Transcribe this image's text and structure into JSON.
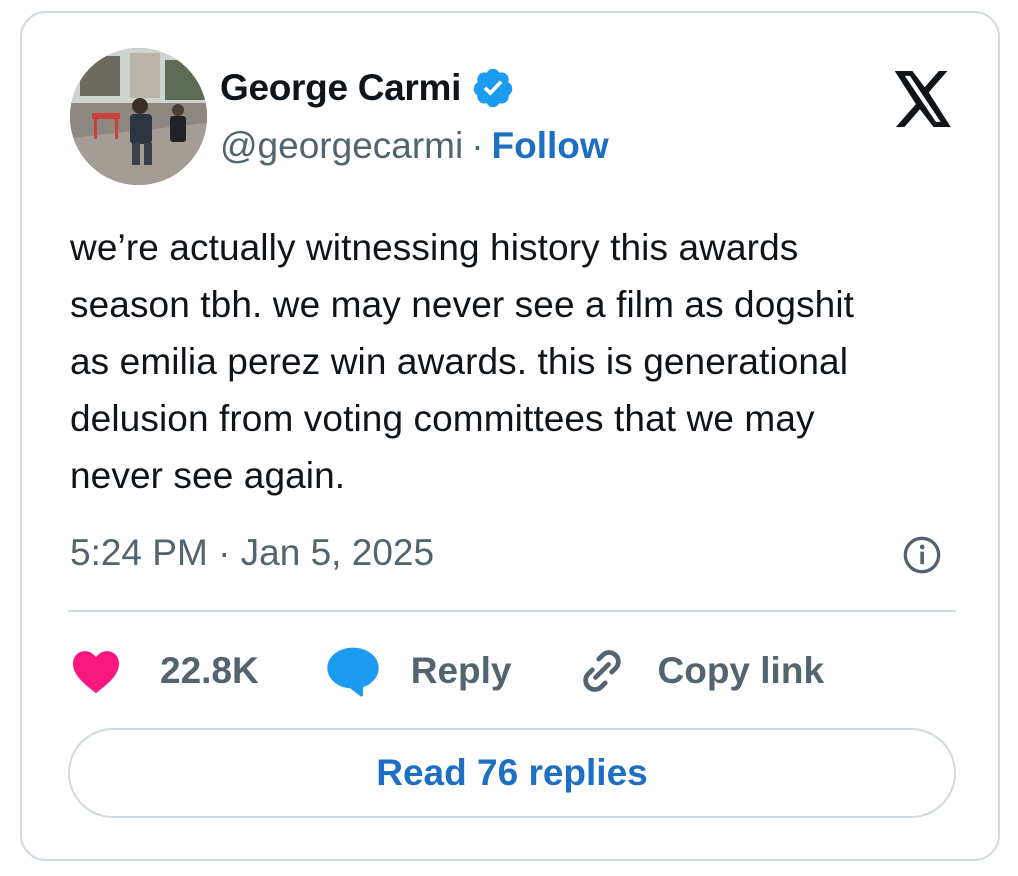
{
  "author": {
    "display_name": "George Carmi",
    "handle": "@georgecarmi",
    "separator": "·",
    "follow_label": "Follow",
    "verified": true,
    "avatar": "avatar-photo"
  },
  "platform_logo": "x-logo-icon",
  "tweet": {
    "text": "we’re actually witnessing history this awards\nseason tbh. we may never see a film as dogshit\nas emilia perez win awards. this is generational\ndelusion from voting committees that we may\nnever see again.",
    "timestamp": "5:24 PM · Jan 5, 2025"
  },
  "actions": {
    "like_count": "22.8K",
    "reply_label": "Reply",
    "copy_link_label": "Copy link"
  },
  "read_replies_label": "Read 76 replies",
  "colors": {
    "like_heart": "#f91880",
    "reply_bubble": "#1d9bf0",
    "link_blue": "#1d6fc4",
    "verified_badge": "#1d9bf0",
    "secondary_text": "#536471",
    "border": "#cfd9de"
  }
}
